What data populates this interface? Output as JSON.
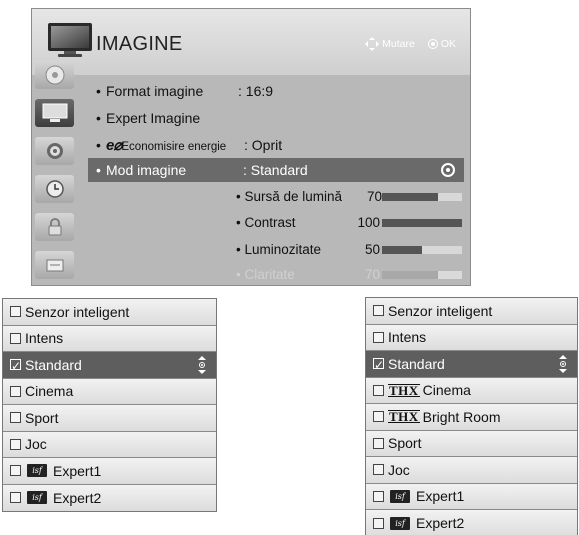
{
  "menu": {
    "title": "IMAGINE",
    "hint_move": "Mutare",
    "hint_ok": "OK",
    "side_icons": [
      "disc-icon",
      "tv-icon",
      "speaker-icon",
      "clock-icon",
      "lock-icon",
      "options-icon",
      "network-icon"
    ],
    "items": {
      "format": {
        "label": "Format imagine",
        "value": ": 16:9"
      },
      "expert": {
        "label": "Expert Imagine"
      },
      "eco": {
        "prefix": "e⌀",
        "label": "Economisire energie",
        "value": ": Oprit"
      },
      "mode": {
        "label": "Mod imagine",
        "value": ": Standard"
      }
    },
    "sub_items": [
      {
        "label": "• Sursă de lumină",
        "value": "70",
        "level": 0.7
      },
      {
        "label": "• Contrast",
        "value": "100",
        "level": 1.0
      },
      {
        "label": "• Luminozitate",
        "value": "50",
        "level": 0.5
      },
      {
        "label": "• Claritate",
        "value": "70",
        "level": 0.7
      }
    ]
  },
  "list_left": {
    "items": [
      {
        "label": "Senzor inteligent"
      },
      {
        "label": "Intens"
      },
      {
        "label": "Standard"
      },
      {
        "label": "Cinema"
      },
      {
        "label": "Sport"
      },
      {
        "label": "Joc"
      },
      {
        "label": "Expert1",
        "icon": "isf"
      },
      {
        "label": "Expert2",
        "icon": "isf"
      }
    ]
  },
  "list_right": {
    "items": [
      {
        "label": "Senzor inteligent"
      },
      {
        "label": "Intens"
      },
      {
        "label": "Standard"
      },
      {
        "label": "Cinema",
        "icon": "THX"
      },
      {
        "label": "Bright Room",
        "icon": "THX"
      },
      {
        "label": "Sport"
      },
      {
        "label": "Joc"
      },
      {
        "label": "Expert1",
        "icon": "isf"
      },
      {
        "label": "Expert2",
        "icon": "isf"
      }
    ]
  },
  "icons": {
    "thx_text": "THX",
    "isf_text": "isf"
  }
}
